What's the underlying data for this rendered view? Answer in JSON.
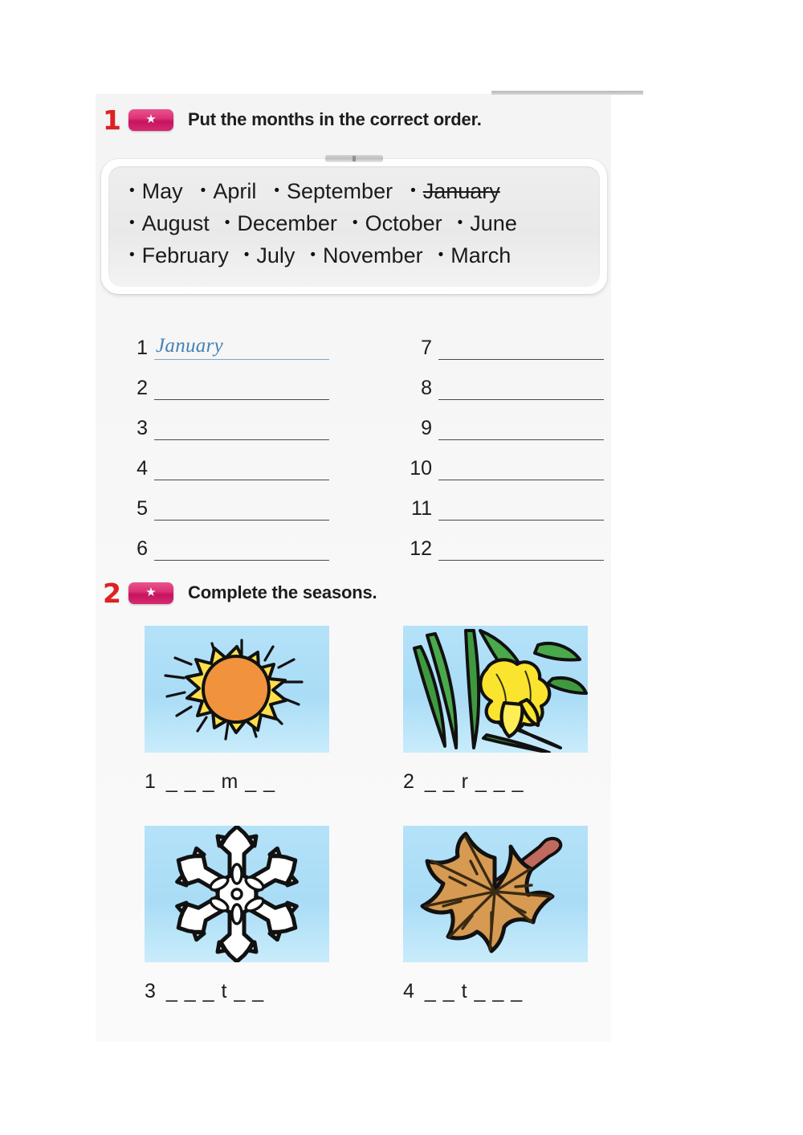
{
  "page": {
    "background": "#ffffff",
    "sheet_background": "#f6f6f6",
    "accent_red": "#e02020",
    "badge_pink": "#d62a6f",
    "answer_ink": "#4682b4"
  },
  "exercises": [
    {
      "number": "1",
      "badge_icon": "star-icon",
      "badge_star": "★",
      "title": "Put the months in the correct order.",
      "word_bank": {
        "rows": [
          [
            {
              "label": "May",
              "used": false
            },
            {
              "label": "April",
              "used": false
            },
            {
              "label": "September",
              "used": false
            },
            {
              "label": "January",
              "used": true
            }
          ],
          [
            {
              "label": "August",
              "used": false
            },
            {
              "label": "December",
              "used": false
            },
            {
              "label": "October",
              "used": false
            },
            {
              "label": "June",
              "used": false
            }
          ],
          [
            {
              "label": "February",
              "used": false
            },
            {
              "label": "July",
              "used": false
            },
            {
              "label": "November",
              "used": false
            },
            {
              "label": "March",
              "used": false
            }
          ]
        ],
        "bullet": "•"
      },
      "answers_left": [
        {
          "number": "1",
          "value": "January"
        },
        {
          "number": "2",
          "value": ""
        },
        {
          "number": "3",
          "value": ""
        },
        {
          "number": "4",
          "value": ""
        },
        {
          "number": "5",
          "value": ""
        },
        {
          "number": "6",
          "value": ""
        }
      ],
      "answers_right": [
        {
          "number": "7",
          "value": ""
        },
        {
          "number": "8",
          "value": ""
        },
        {
          "number": "9",
          "value": ""
        },
        {
          "number": "10",
          "value": ""
        },
        {
          "number": "11",
          "value": ""
        },
        {
          "number": "12",
          "value": ""
        }
      ]
    },
    {
      "number": "2",
      "badge_icon": "star-icon",
      "badge_star": "★",
      "title": "Complete the seasons.",
      "items": [
        {
          "number": "1",
          "pattern": "_ _ _ m _ _",
          "image": "sun-icon"
        },
        {
          "number": "2",
          "pattern": "_ _ r _ _ _",
          "image": "daffodil-icon"
        },
        {
          "number": "3",
          "pattern": "_ _ _ t _ _",
          "image": "snowflake-icon"
        },
        {
          "number": "4",
          "pattern": "_ _ t _ _ _",
          "image": "autumn-leaf-icon"
        }
      ]
    }
  ]
}
